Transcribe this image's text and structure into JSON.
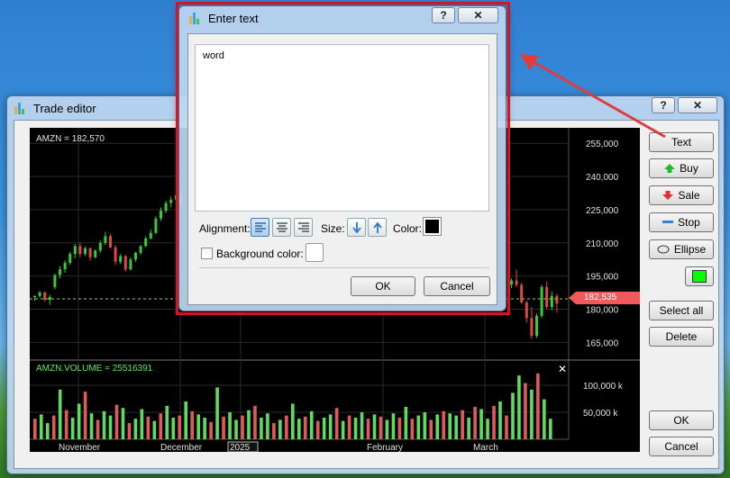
{
  "trade_editor": {
    "title": "Trade editor",
    "help": "?",
    "close": "✕",
    "buttons": {
      "text": "Text",
      "buy": "Buy",
      "sale": "Sale",
      "stop": "Stop",
      "ellipse": "Ellipse",
      "select_all": "Select all",
      "delete": "Delete",
      "ok": "OK",
      "cancel": "Cancel"
    },
    "color_swatch": "#00ff00"
  },
  "chart": {
    "price_label": "AMZN = 182,570",
    "volume_label": "AMZN.VOLUME = 25516391",
    "current_price": "182,535",
    "price_ticks": [
      "255,000",
      "240,000",
      "225,000",
      "210,000",
      "195,000",
      "180,000",
      "165,000"
    ],
    "volume_ticks": [
      "100,000 k",
      "50,000 k"
    ],
    "x_labels": [
      "November",
      "December",
      "2025",
      "February",
      "March"
    ],
    "up_color": "#33cc33",
    "down_color": "#e04848"
  },
  "chart_data": {
    "type": "candlestick",
    "price_ylim": [
      157000,
      262000
    ],
    "volume_ylim": [
      0,
      140000
    ],
    "candles": [
      [
        185.5,
        186.2,
        183.8,
        185.9
      ],
      [
        186.0,
        188.3,
        185.1,
        187.6
      ],
      [
        187.6,
        188.0,
        183.5,
        184.2
      ],
      [
        184.2,
        186.5,
        182.0,
        185.5
      ],
      [
        190.0,
        196.0,
        189.0,
        195.5
      ],
      [
        195.5,
        199.5,
        194.0,
        198.0
      ],
      [
        198.0,
        202.0,
        196.5,
        201.0
      ],
      [
        201.0,
        206.0,
        200.0,
        205.0
      ],
      [
        205.0,
        209.5,
        203.0,
        208.5
      ],
      [
        208.5,
        210.0,
        203.5,
        205.0
      ],
      [
        205.0,
        208.5,
        204.0,
        207.5
      ],
      [
        207.5,
        208.0,
        202.0,
        203.5
      ],
      [
        203.5,
        207.0,
        203.0,
        206.5
      ],
      [
        206.5,
        211.0,
        205.5,
        210.0
      ],
      [
        210.0,
        215.0,
        209.0,
        213.0
      ],
      [
        213.0,
        214.0,
        207.5,
        208.0
      ],
      [
        208.0,
        209.0,
        200.0,
        201.5
      ],
      [
        201.5,
        205.0,
        200.5,
        204.0
      ],
      [
        204.0,
        204.5,
        197.0,
        198.0
      ],
      [
        198.0,
        203.5,
        197.5,
        202.5
      ],
      [
        202.5,
        206.0,
        201.5,
        205.5
      ],
      [
        205.5,
        209.0,
        204.5,
        208.5
      ],
      [
        208.5,
        213.0,
        208.0,
        212.0
      ],
      [
        212.0,
        216.0,
        211.5,
        214.5
      ],
      [
        214.5,
        222.0,
        214.0,
        221.0
      ],
      [
        221.0,
        226.0,
        220.0,
        224.5
      ],
      [
        224.5,
        229.0,
        223.5,
        228.0
      ],
      [
        228.0,
        231.0,
        226.0,
        229.5
      ],
      [
        229.5,
        233.0,
        228.5,
        231.5
      ],
      [
        231.5,
        232.0,
        226.0,
        227.0
      ],
      [
        191.0,
        194.0,
        189.5,
        193.0
      ],
      [
        193.0,
        198.0,
        190.0,
        191.0
      ],
      [
        191.0,
        192.0,
        182.5,
        183.0
      ],
      [
        183.0,
        184.0,
        174.0,
        176.0
      ],
      [
        176.0,
        181.0,
        166.5,
        168.0
      ],
      [
        168.0,
        178.0,
        167.0,
        177.0
      ],
      [
        177.0,
        191.0,
        176.0,
        190.0
      ],
      [
        190.0,
        192.5,
        180.0,
        181.0
      ],
      [
        181.0,
        188.0,
        179.5,
        186.0
      ],
      [
        186.0,
        187.0,
        178.5,
        182.5
      ]
    ],
    "volumes": [
      38,
      46,
      30,
      44,
      92,
      54,
      40,
      66,
      88,
      48,
      36,
      52,
      44,
      64,
      58,
      30,
      38,
      56,
      42,
      34,
      48,
      62,
      40,
      44,
      70,
      52,
      46,
      40,
      32,
      96,
      42,
      50,
      36,
      44,
      54,
      62,
      40,
      48,
      30,
      36,
      44,
      66,
      38,
      42,
      52,
      34,
      40,
      46,
      58,
      34,
      44,
      40,
      50,
      38,
      46,
      42,
      36,
      48,
      40,
      60,
      38,
      44,
      50,
      36,
      46,
      52,
      48,
      44,
      54,
      40,
      60,
      56,
      38,
      62,
      70,
      44,
      86,
      118,
      104,
      92,
      122,
      74,
      38
    ]
  },
  "dialog": {
    "title": "Enter text",
    "help": "?",
    "close": "✕",
    "text_value": "word",
    "alignment_label": "Alignment:",
    "size_label": "Size:",
    "color_label": "Color:",
    "color_value": "#000000",
    "background_label": "Background color:",
    "background_checked": false,
    "ok": "OK",
    "cancel": "Cancel"
  }
}
